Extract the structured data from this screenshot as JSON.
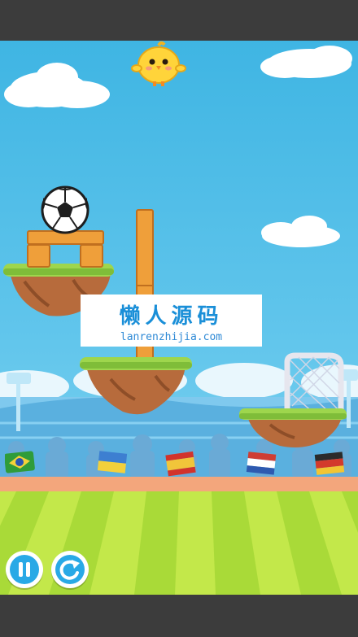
{
  "watermark": {
    "title": "懒人源码",
    "url": "lanrenzhijia.com"
  },
  "controls": {
    "pause_icon": "pause-icon",
    "restart_icon": "restart-arrow-icon"
  },
  "colors": {
    "sky": "#4dbbe8",
    "grass": "#9fd94f",
    "dirt": "#b0683a",
    "wood": "#e9a13f",
    "pitch_light": "#c6ea4e",
    "pitch_dark": "#a8db3a",
    "button_blue": "#29a9e6"
  },
  "flags": [
    "brazil-flag",
    "ukraine-flag",
    "spain-flag",
    "netherlands-flag",
    "germany-flag"
  ]
}
